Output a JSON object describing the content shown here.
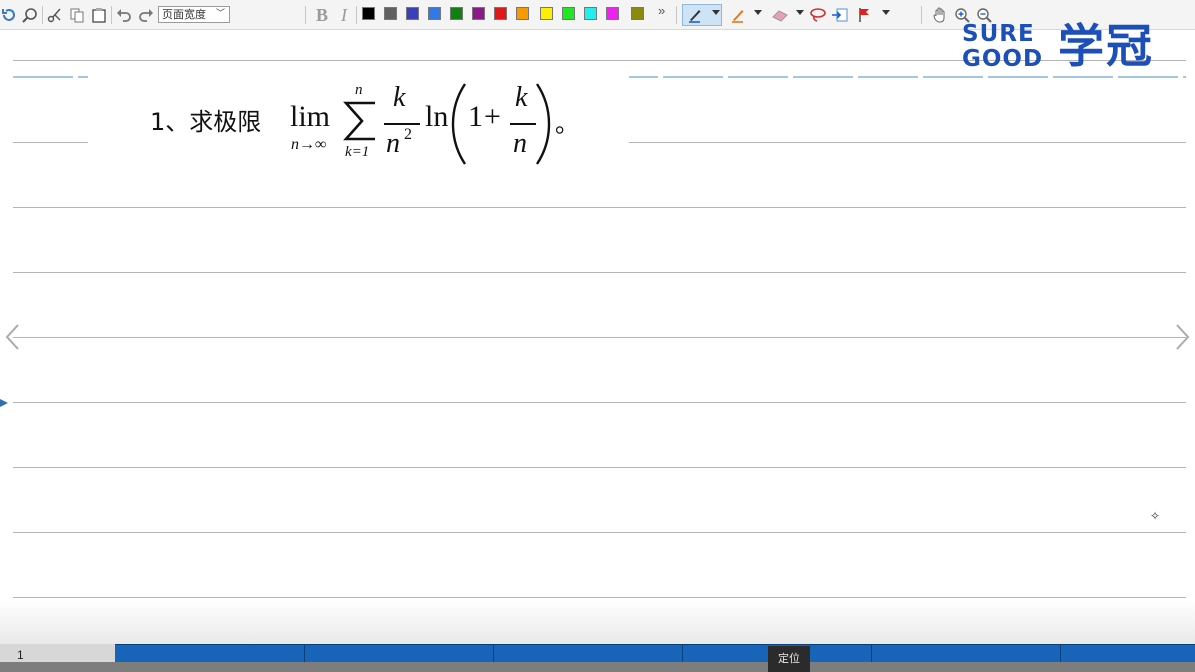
{
  "toolbar": {
    "zoom_select": "页面宽度",
    "bold_label": "B",
    "italic_label": "I",
    "more_label": "»",
    "colors": [
      "#000000",
      "#606060",
      "#3b3fb8",
      "#3478e6",
      "#108010",
      "#8a1a8a",
      "#e01818",
      "#f59a00",
      "#ffee00",
      "#22e622",
      "#22eeee",
      "#ee22ee",
      "#8a8a10"
    ],
    "icons": [
      "refresh-icon",
      "zoom-page-icon",
      "cut-icon",
      "copy-icon",
      "paste-icon",
      "undo-icon",
      "redo-icon",
      "pen-icon",
      "highlighter-icon",
      "eraser-icon",
      "lasso-icon",
      "insert-icon",
      "flag-icon",
      "hand-icon",
      "zoom-in-icon",
      "zoom-out-icon"
    ]
  },
  "logo": {
    "line1": "SURE",
    "line2": "GOOD",
    "cn": "学冠",
    "color": "#1d4fb8"
  },
  "problem": {
    "label": "1、求极限",
    "lim": "lim",
    "lim_sub": "n→∞",
    "sum_sup": "n",
    "sum_sub": "k=1",
    "frac_num": "k",
    "frac_den": "n",
    "frac_den_exp": "2",
    "ln": "ln",
    "inner_one": "1",
    "inner_plus": "+",
    "inner_num": "k",
    "inner_den": "n",
    "end_mark": "。"
  },
  "cursor_mark": "✧",
  "status": {
    "page_number": "1",
    "locate_button": "定位",
    "progress_color": "#1764b8"
  }
}
